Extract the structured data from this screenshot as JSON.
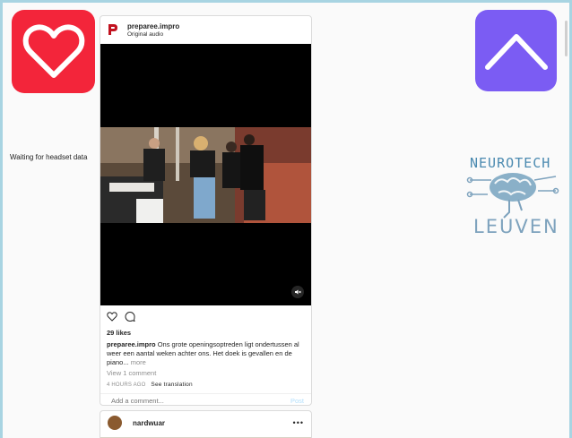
{
  "status": {
    "text": "Waiting for headset data"
  },
  "logo": {
    "top": "NEUROTECH",
    "bottom": "LEUVEN"
  },
  "post": {
    "username": "preparee.impro",
    "audio": "Original audio",
    "likes": "29 likes",
    "caption_user": "preparee.impro",
    "caption_text": "Ons grote openingsoptreden ligt ondertussen al weer een aantal weken achter ons. Het doek is gevallen en de piano...",
    "caption_more": "more",
    "comments_link": "View 1 comment",
    "time": "4 HOURS AGO",
    "translate": "See translation",
    "comment_placeholder": "Add a comment...",
    "post_label": "Post"
  },
  "post2": {
    "username": "nardwuar",
    "menu": "•••"
  },
  "colors": {
    "heart": "#f3253a",
    "up": "#7b5cf3",
    "accent": "#b2dffc"
  },
  "icons": [
    "heart-icon",
    "chevron-up-icon",
    "like-icon",
    "comment-icon",
    "mute-icon"
  ]
}
